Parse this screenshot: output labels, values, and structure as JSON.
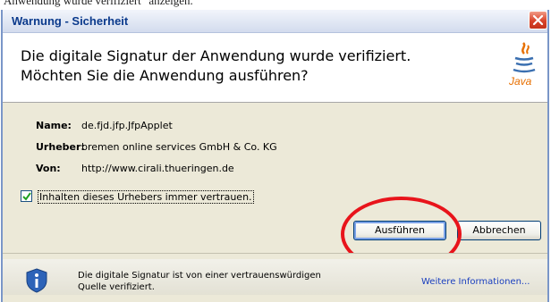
{
  "background_caption": "Anwendung wurde verifiziert\" anzeigen.",
  "dialog": {
    "title": "Warnung - Sicherheit",
    "message_line1": "Die digitale Signatur der Anwendung wurde verifiziert.",
    "message_line2": "Möchten Sie die Anwendung ausführen?",
    "java_logo_text": "Java",
    "info": [
      {
        "label": "Name:",
        "value": "de.fjd.jfp.JfpApplet"
      },
      {
        "label": "Urheber:",
        "value": "bremen online services GmbH & Co. KG"
      },
      {
        "label": "Von:",
        "value": "http://www.cirali.thueringen.de"
      }
    ],
    "checkbox": {
      "label": "Inhalten dieses Urhebers immer vertrauen.",
      "checked": true
    },
    "buttons": {
      "run": "Ausführen",
      "cancel": "Abbrechen"
    },
    "footer": {
      "text": "Die digitale Signatur ist von einer vertrauenswürdigen Quelle verifiziert.",
      "more_info": "Weitere Informationen..."
    }
  },
  "colors": {
    "highlight_circle": "#e8141b",
    "title_text": "#0b3a8c",
    "link": "#1a3fbf",
    "java_orange": "#e76f00"
  }
}
